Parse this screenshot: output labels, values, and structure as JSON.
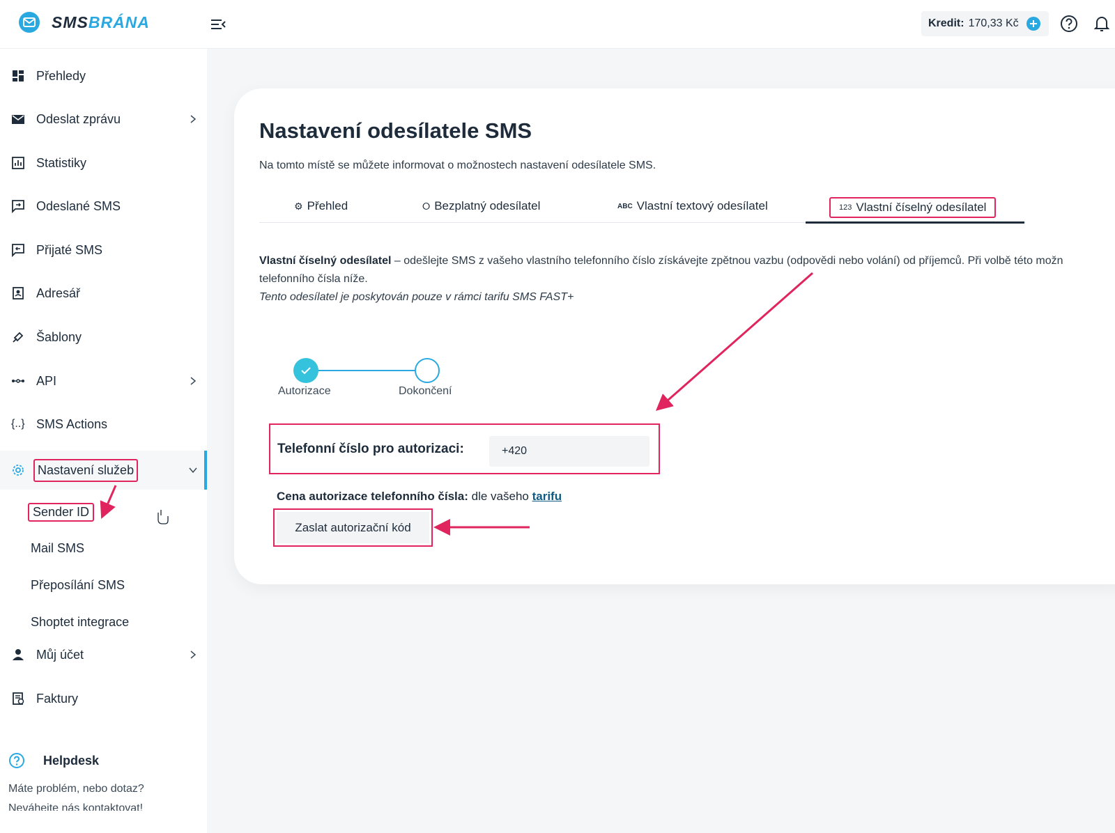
{
  "header": {
    "logo_sms": "SMS",
    "logo_brana": "BRÁNA",
    "credit_label": "Kredit:",
    "credit_value": "170,33 Kč"
  },
  "sidebar": {
    "items": [
      {
        "label": "Přehledy",
        "icon": "dashboard-icon"
      },
      {
        "label": "Odeslat zprávu",
        "icon": "envelope-icon"
      },
      {
        "label": "Statistiky",
        "icon": "chart-icon"
      },
      {
        "label": "Odeslané SMS",
        "icon": "sent-icon"
      },
      {
        "label": "Přijaté SMS",
        "icon": "inbox-icon"
      },
      {
        "label": "Adresář",
        "icon": "contacts-icon"
      },
      {
        "label": "Šablony",
        "icon": "template-icon"
      },
      {
        "label": "API",
        "icon": "api-icon"
      },
      {
        "label": "SMS Actions",
        "icon": "braces-icon"
      },
      {
        "label": "Nastavení služeb",
        "icon": "gear-icon"
      },
      {
        "label": "Můj účet",
        "icon": "user-icon"
      },
      {
        "label": "Faktury",
        "icon": "invoice-icon"
      }
    ],
    "sub_items": [
      "Sender ID",
      "Mail SMS",
      "Přeposílání SMS",
      "Shoptet integrace"
    ],
    "helpdesk": {
      "title": "Helpdesk",
      "line1": "Máte problém, nebo dotaz?",
      "line2": "Neváhejte nás kontaktovat!"
    }
  },
  "main": {
    "title": "Nastavení odesílatele SMS",
    "subtitle": "Na tomto místě se můžete informovat o možnostech nastavení odesílatele SMS.",
    "tabs": [
      {
        "label": "Přehled",
        "icon": "⚙"
      },
      {
        "label": "Bezplatný odesílatel",
        "icon": "⭘"
      },
      {
        "label": "Vlastní textový odesílatel",
        "icon": "ABC"
      },
      {
        "label": "Vlastní číselný odesílatel",
        "icon": "123"
      }
    ],
    "desc_bold": "Vlastní číselný odesílatel",
    "desc_rest": " – odešlejte SMS z vašeho vlastního telefonního číslo získávejte zpětnou vazbu (odpovědi nebo volání) od příjemců. Při volbě této možn",
    "desc_line2": "telefonního čísla níže.",
    "desc_italic": "Tento odesílatel je poskytován pouze v rámci tarifu SMS FAST+",
    "steps": [
      "Autorizace",
      "Dokončení"
    ],
    "phone_label": "Telefonní číslo pro autorizaci:",
    "phone_value": "+420",
    "price_label": "Cena autorizace telefonního čísla:",
    "price_text": " dle vašeho ",
    "price_link": "tarifu",
    "send_button": "Zaslat autorizační kód"
  },
  "colors": {
    "accent": "#2aa8e0",
    "highlight": "#e0245e",
    "step_done": "#35c2dc"
  }
}
